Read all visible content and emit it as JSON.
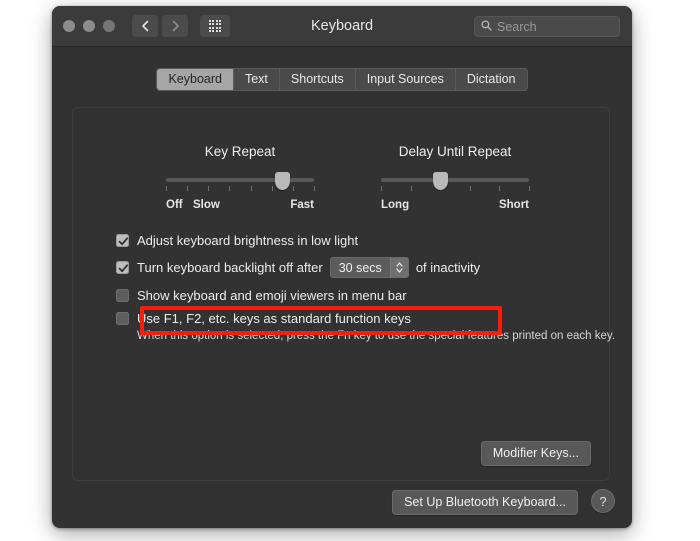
{
  "window": {
    "title": "Keyboard",
    "traffic_lights": [
      "close",
      "minimize",
      "zoom"
    ],
    "nav": {
      "back_icon": "chevron-left-icon",
      "forward_icon": "chevron-right-icon",
      "grid_icon": "show-all-grid-icon"
    },
    "search": {
      "placeholder": "Search",
      "value": "",
      "icon": "search-icon"
    }
  },
  "tabs": [
    {
      "label": "Keyboard",
      "active": true
    },
    {
      "label": "Text",
      "active": false
    },
    {
      "label": "Shortcuts",
      "active": false
    },
    {
      "label": "Input Sources",
      "active": false
    },
    {
      "label": "Dictation",
      "active": false
    }
  ],
  "sliders": [
    {
      "title": "Key Repeat",
      "min_label": "Off",
      "second_label": "Slow",
      "max_label": "Fast",
      "ticks": 8,
      "value_percent": 79
    },
    {
      "title": "Delay Until Repeat",
      "min_label": "Long",
      "max_label": "Short",
      "ticks": 6,
      "value_percent": 40
    }
  ],
  "options": [
    {
      "label": "Adjust keyboard brightness in low light",
      "checked": true,
      "check_icon": "checkmark-icon"
    },
    {
      "label_before": "Turn keyboard backlight off after",
      "label_after": "of inactivity",
      "checked": true,
      "check_icon": "checkmark-icon",
      "stepper": {
        "value": "30 secs",
        "icon": "stepper-up-down-icon"
      },
      "highlighted": true
    },
    {
      "label": "Show keyboard and emoji viewers in menu bar",
      "checked": false
    },
    {
      "label": "Use F1, F2, etc. keys as standard function keys",
      "checked": false,
      "help_text": "When this option is selected, press the Fn key to use the special features printed on each key."
    }
  ],
  "buttons": {
    "modifier_keys": "Modifier Keys...",
    "setup_bluetooth": "Set Up Bluetooth Keyboard...",
    "help": "?"
  },
  "colors": {
    "highlight": "#fb1c09",
    "window_bg": "#323232",
    "titlebar_bg": "#3b3b3b",
    "accent_tab": "#a6a6a6"
  }
}
